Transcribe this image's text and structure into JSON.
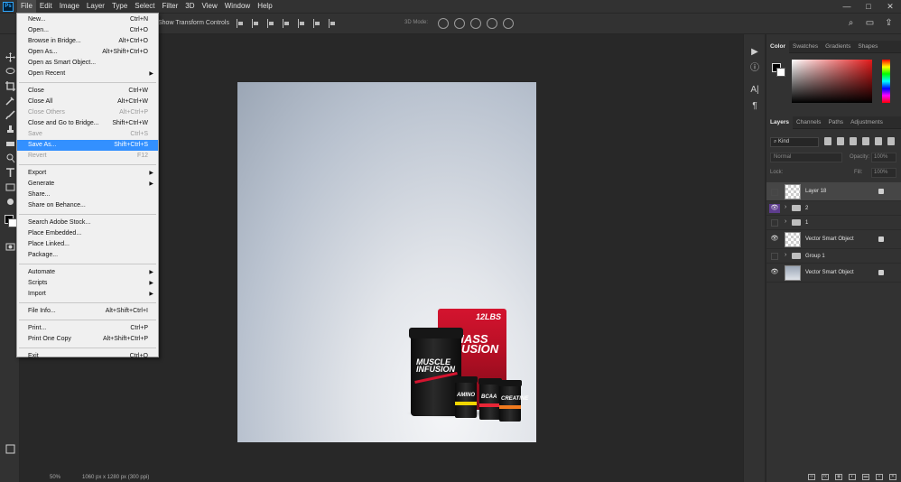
{
  "app": {
    "logo": "Ps",
    "menu": [
      "File",
      "Edit",
      "Image",
      "Layer",
      "Type",
      "Select",
      "Filter",
      "3D",
      "View",
      "Window",
      "Help"
    ],
    "active_menu": "File",
    "window_controls": [
      "—",
      "□",
      "✕"
    ]
  },
  "options_bar": {
    "transform_label": "Show Transform Controls",
    "mode_3d_label": "3D Mode:"
  },
  "status_bar": {
    "zoom": "50%",
    "doc_info": "1060 px x 1280 px (300 ppi)"
  },
  "file_menu": {
    "groups": [
      [
        {
          "label": "New...",
          "shortcut": "Ctrl+N"
        },
        {
          "label": "Open...",
          "shortcut": "Ctrl+O"
        },
        {
          "label": "Browse in Bridge...",
          "shortcut": "Alt+Ctrl+O"
        },
        {
          "label": "Open As...",
          "shortcut": "Alt+Shift+Ctrl+O"
        },
        {
          "label": "Open as Smart Object...",
          "shortcut": ""
        },
        {
          "label": "Open Recent",
          "shortcut": "",
          "submenu": true
        }
      ],
      [
        {
          "label": "Close",
          "shortcut": "Ctrl+W"
        },
        {
          "label": "Close All",
          "shortcut": "Alt+Ctrl+W"
        },
        {
          "label": "Close Others",
          "shortcut": "Alt+Ctrl+P",
          "disabled": true
        },
        {
          "label": "Close and Go to Bridge...",
          "shortcut": "Shift+Ctrl+W"
        },
        {
          "label": "Save",
          "shortcut": "Ctrl+S",
          "disabled": true
        },
        {
          "label": "Save As...",
          "shortcut": "Shift+Ctrl+S",
          "highlight": true
        },
        {
          "label": "Revert",
          "shortcut": "F12",
          "disabled": true
        }
      ],
      [
        {
          "label": "Export",
          "shortcut": "",
          "submenu": true
        },
        {
          "label": "Generate",
          "shortcut": "",
          "submenu": true
        },
        {
          "label": "Share...",
          "shortcut": ""
        },
        {
          "label": "Share on Behance...",
          "shortcut": ""
        }
      ],
      [
        {
          "label": "Search Adobe Stock...",
          "shortcut": ""
        },
        {
          "label": "Place Embedded...",
          "shortcut": ""
        },
        {
          "label": "Place Linked...",
          "shortcut": ""
        },
        {
          "label": "Package...",
          "shortcut": ""
        }
      ],
      [
        {
          "label": "Automate",
          "shortcut": "",
          "submenu": true
        },
        {
          "label": "Scripts",
          "shortcut": "",
          "submenu": true
        },
        {
          "label": "Import",
          "shortcut": "",
          "submenu": true
        }
      ],
      [
        {
          "label": "File Info...",
          "shortcut": "Alt+Shift+Ctrl+I"
        }
      ],
      [
        {
          "label": "Print...",
          "shortcut": "Ctrl+P"
        },
        {
          "label": "Print One Copy",
          "shortcut": "Alt+Shift+Ctrl+P"
        }
      ],
      [
        {
          "label": "Exit",
          "shortcut": "Ctrl+Q"
        }
      ]
    ]
  },
  "color_panel": {
    "tabs": [
      "Color",
      "Swatches",
      "Gradients",
      "Shapes"
    ],
    "active_tab": "Color",
    "foreground": "#000000",
    "background": "#ffffff",
    "hue": "#e21a1a"
  },
  "layers_panel": {
    "tabs": [
      "Layers",
      "Channels",
      "Paths",
      "Adjustments"
    ],
    "active_tab": "Layers",
    "filter_label": "Kind",
    "blend_mode": "Normal",
    "opacity_label": "Opacity:",
    "opacity_value": "100%",
    "lock_label": "Lock:",
    "fill_label": "Fill:",
    "fill_value": "100%",
    "layers": [
      {
        "name": "Layer 18",
        "visible": false,
        "kind": "smart",
        "selected": true,
        "locked": true
      },
      {
        "name": "2",
        "visible": true,
        "kind": "group",
        "color_tag": "purple"
      },
      {
        "name": "1",
        "visible": false,
        "kind": "group",
        "color_tag": "purple"
      },
      {
        "name": "Vector Smart Object",
        "visible": true,
        "kind": "smart",
        "locked": true
      },
      {
        "name": "Group 1",
        "visible": false,
        "kind": "group"
      },
      {
        "name": "Vector Smart Object",
        "visible": true,
        "kind": "image",
        "locked": true
      }
    ]
  },
  "canvas": {
    "bag_brand": "MASS FUSION",
    "bag_weight": "12LBS",
    "tub_brand": "MUSCLE INFUSION",
    "small_tubs": [
      "AMINO",
      "BCAA",
      "CREATINE"
    ]
  }
}
